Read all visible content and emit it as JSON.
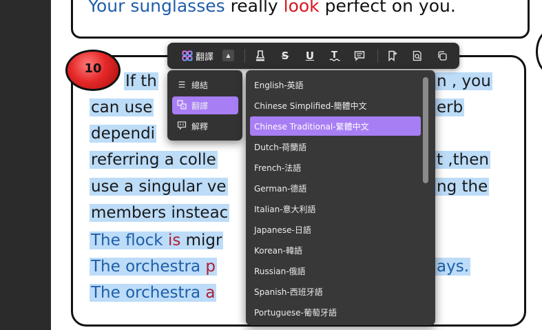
{
  "document": {
    "top_sentence": {
      "part1": "Your sunglasses",
      "part2": " really ",
      "part3": "look",
      "part4": " perfect on you."
    },
    "badge_number": "10",
    "lines": [
      {
        "text": "If th",
        "tail": "n , you"
      },
      {
        "text": "can use",
        "tail": "erb"
      },
      {
        "text": "dependi",
        "tail": ""
      },
      {
        "text": "referring a colle",
        "tail": "t ,then"
      },
      {
        "text": "use a singular ve",
        "tail": "ng the"
      },
      {
        "text": "members insteac",
        "tail": ""
      },
      {
        "text_a": "The flock ",
        "text_b": "is",
        "text_c": " migr",
        "tail": ""
      },
      {
        "text_a": "The orchestra ",
        "text_b": "p",
        "tail": "ays."
      },
      {
        "text_a": "The orchestra ",
        "text_b": "a",
        "tail": ""
      }
    ]
  },
  "toolbar": {
    "app_icon": "ai-sparkle-icon",
    "translate_label": "翻譯",
    "caret_icon": "caret-up-icon",
    "tools": [
      "highlighter-icon",
      "strikethrough-icon",
      "underline-icon",
      "squiggly-underline-icon",
      "comment-icon",
      "add-bookmark-icon",
      "search-document-icon",
      "copy-icon"
    ]
  },
  "ai_menu": {
    "items": [
      {
        "label": "總結",
        "icon": "list-icon",
        "active": false
      },
      {
        "label": "翻譯",
        "icon": "translate-icon",
        "active": true
      },
      {
        "label": "解釋",
        "icon": "explain-icon",
        "active": false
      }
    ]
  },
  "language_menu": {
    "selected": "Chinese Traditional-繁體中文",
    "items": [
      "English-英語",
      "Chinese Simplified-簡體中文",
      "Chinese Traditional-繁體中文",
      "Dutch-荷蘭語",
      "French-法語",
      "German-德語",
      "Italian-意大利語",
      "Japanese-日語",
      "Korean-韓語",
      "Russian-俄語",
      "Spanish-西班牙語",
      "Portuguese-葡萄牙語"
    ]
  },
  "colors": {
    "accent": "#a87ef5",
    "highlight": "#bcdcf8",
    "toolbar_bg": "#2e2e2e",
    "menu_bg": "#383838"
  }
}
